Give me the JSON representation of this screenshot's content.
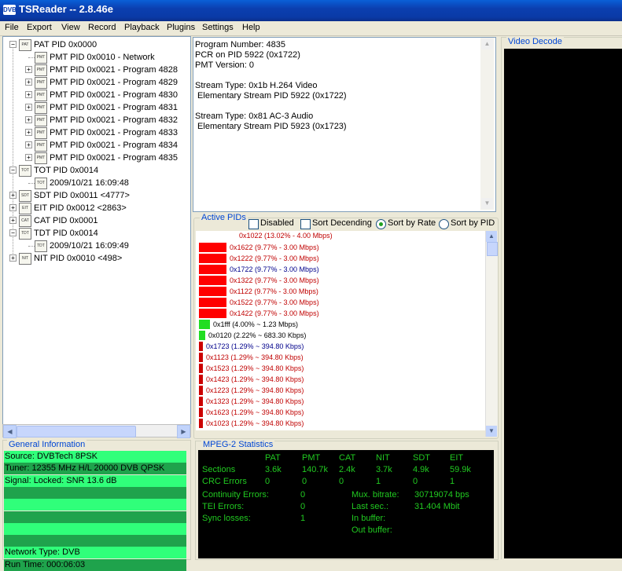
{
  "window": {
    "logo": "DVB",
    "title": "TSReader -- 2.8.46e",
    "accent": "#0b3fb0"
  },
  "menu": [
    "File",
    "Export",
    "View",
    "Record",
    "Playback",
    "Plugins",
    "Settings",
    "Help"
  ],
  "tree": [
    {
      "label": "PAT PID 0x0000",
      "icon": "PAT",
      "expander": "minus"
    },
    {
      "label": "PMT PID 0x0010 - Network",
      "icon": "PMT",
      "expander": "none"
    },
    {
      "label": "PMT PID 0x0021 - Program 4828",
      "icon": "PMT",
      "expander": "plus"
    },
    {
      "label": "PMT PID 0x0021 - Program 4829",
      "icon": "PMT",
      "expander": "plus"
    },
    {
      "label": "PMT PID 0x0021 - Program 4830",
      "icon": "PMT",
      "expander": "plus"
    },
    {
      "label": "PMT PID 0x0021 - Program 4831",
      "icon": "PMT",
      "expander": "plus"
    },
    {
      "label": "PMT PID 0x0021 - Program 4832",
      "icon": "PMT",
      "expander": "plus"
    },
    {
      "label": "PMT PID 0x0021 - Program 4833",
      "icon": "PMT",
      "expander": "plus"
    },
    {
      "label": "PMT PID 0x0021 - Program 4834",
      "icon": "PMT",
      "expander": "plus"
    },
    {
      "label": "PMT PID 0x0021 - Program 4835",
      "icon": "PMT",
      "expander": "plus"
    },
    {
      "label": "TOT PID 0x0014",
      "icon": "TOT",
      "expander": "minus"
    },
    {
      "label": "2009/10/21 16:09:48",
      "icon": "TOT",
      "expander": "none"
    },
    {
      "label": "SDT PID 0x0011 <4777>",
      "icon": "SDT",
      "expander": "plus"
    },
    {
      "label": "EIT PID 0x0012 <2863>",
      "icon": "EIT",
      "expander": "plus"
    },
    {
      "label": "CAT PID 0x0001",
      "icon": "CAT",
      "expander": "plus"
    },
    {
      "label": "TDT PID 0x0014",
      "icon": "TDT",
      "expander": "minus"
    },
    {
      "label": "2009/10/21 16:09:49",
      "icon": "TDT",
      "expander": "none"
    },
    {
      "label": "NIT PID 0x0010 <498>",
      "icon": "NIT",
      "expander": "plus"
    }
  ],
  "program_info": [
    "Program Number: 4835",
    "PCR on PID 5922 (0x1722)",
    "PMT Version: 0",
    "",
    "Stream Type: 0x1b H.264 Video",
    " Elementary Stream PID 5922 (0x1722)",
    "",
    "Stream Type: 0x81 AC-3 Audio",
    " Elementary Stream PID 5923 (0x1723)"
  ],
  "active_pids": {
    "title": "Active PIDs",
    "options": {
      "disabled": {
        "label": "Disabled",
        "checked": false
      },
      "sort_descending": {
        "label": "Sort Decending",
        "checked": false
      },
      "sort_by_rate": {
        "label": "Sort by Rate",
        "selected": true
      },
      "sort_by_pid": {
        "label": "Sort by PID",
        "selected": false
      }
    },
    "rows": [
      {
        "label": "0x1022 (13.02% - 4.00 Mbps)",
        "pct": 13.02,
        "color": "#ff0000",
        "text_color": "#c00000"
      },
      {
        "label": "0x1622 (9.77% - 3.00 Mbps)",
        "pct": 9.77,
        "color": "#ff0000",
        "text_color": "#c00000"
      },
      {
        "label": "0x1222 (9.77% - 3.00 Mbps)",
        "pct": 9.77,
        "color": "#ff0000",
        "text_color": "#c00000"
      },
      {
        "label": "0x1722 (9.77% - 3.00 Mbps)",
        "pct": 9.77,
        "color": "#ff0000",
        "text_color": "#00008b"
      },
      {
        "label": "0x1322 (9.77% - 3.00 Mbps)",
        "pct": 9.77,
        "color": "#ff0000",
        "text_color": "#c00000"
      },
      {
        "label": "0x1122 (9.77% - 3.00 Mbps)",
        "pct": 9.77,
        "color": "#ff0000",
        "text_color": "#c00000"
      },
      {
        "label": "0x1522 (9.77% - 3.00 Mbps)",
        "pct": 9.77,
        "color": "#ff0000",
        "text_color": "#c00000"
      },
      {
        "label": "0x1422 (9.77% - 3.00 Mbps)",
        "pct": 9.77,
        "color": "#ff0000",
        "text_color": "#c00000"
      },
      {
        "label": "0x1fff (4.00% ~ 1.23 Mbps)",
        "pct": 4.0,
        "color": "#22dd22",
        "text_color": "#000000"
      },
      {
        "label": "0x0120 (2.22% ~ 683.30 Kbps)",
        "pct": 2.22,
        "color": "#22dd22",
        "text_color": "#000000"
      },
      {
        "label": "0x1723 (1.29% ~ 394.80 Kbps)",
        "pct": 1.29,
        "color": "#cc0000",
        "text_color": "#00008b"
      },
      {
        "label": "0x1123 (1.29% ~ 394.80 Kbps)",
        "pct": 1.29,
        "color": "#cc0000",
        "text_color": "#c00000"
      },
      {
        "label": "0x1523 (1.29% ~ 394.80 Kbps)",
        "pct": 1.29,
        "color": "#cc0000",
        "text_color": "#c00000"
      },
      {
        "label": "0x1423 (1.29% ~ 394.80 Kbps)",
        "pct": 1.29,
        "color": "#cc0000",
        "text_color": "#c00000"
      },
      {
        "label": "0x1223 (1.29% ~ 394.80 Kbps)",
        "pct": 1.29,
        "color": "#cc0000",
        "text_color": "#c00000"
      },
      {
        "label": "0x1323 (1.29% ~ 394.80 Kbps)",
        "pct": 1.29,
        "color": "#cc0000",
        "text_color": "#c00000"
      },
      {
        "label": "0x1623 (1.29% ~ 394.80 Kbps)",
        "pct": 1.29,
        "color": "#cc0000",
        "text_color": "#c00000"
      },
      {
        "label": "0x1023 (1.29% ~ 394.80 Kbps)",
        "pct": 1.29,
        "color": "#cc0000",
        "text_color": "#c00000"
      }
    ]
  },
  "video_decode": {
    "title": "Video Decode"
  },
  "general_info": {
    "title": "General Information",
    "lines": [
      "Source: DVBTech 8PSK",
      "Tuner: 12355 MHz H/L 20000 DVB QPSK",
      "Signal: Locked: SNR 13.6 dB",
      "",
      "",
      "",
      "",
      "",
      "Network Type: DVB",
      "Run Time: 000:06:03"
    ],
    "stripe_colors": [
      "#30ff7a",
      "#1fa34c"
    ]
  },
  "mpeg2": {
    "title": "MPEG-2 Statistics",
    "columns": [
      "PAT",
      "PMT",
      "CAT",
      "NIT",
      "SDT",
      "EIT"
    ],
    "sections_label": "Sections",
    "sections": [
      "3.6k",
      "140.7k",
      "2.4k",
      "3.7k",
      "4.9k",
      "59.9k"
    ],
    "crc_label": "CRC Errors",
    "crc": [
      "0",
      "0",
      "0",
      "1",
      "0",
      "1"
    ],
    "continuity_label": "Continuity Errors:",
    "continuity": "0",
    "tei_label": "TEI Errors:",
    "tei": "0",
    "sync_label": "Sync losses:",
    "sync": "1",
    "mux_label": "Mux. bitrate:",
    "mux": "30719074 bps",
    "last_label": "Last sec.:",
    "last": "31.404 Mbit",
    "inbuf_label": "In buffer:",
    "outbuf_label": "Out buffer:"
  }
}
